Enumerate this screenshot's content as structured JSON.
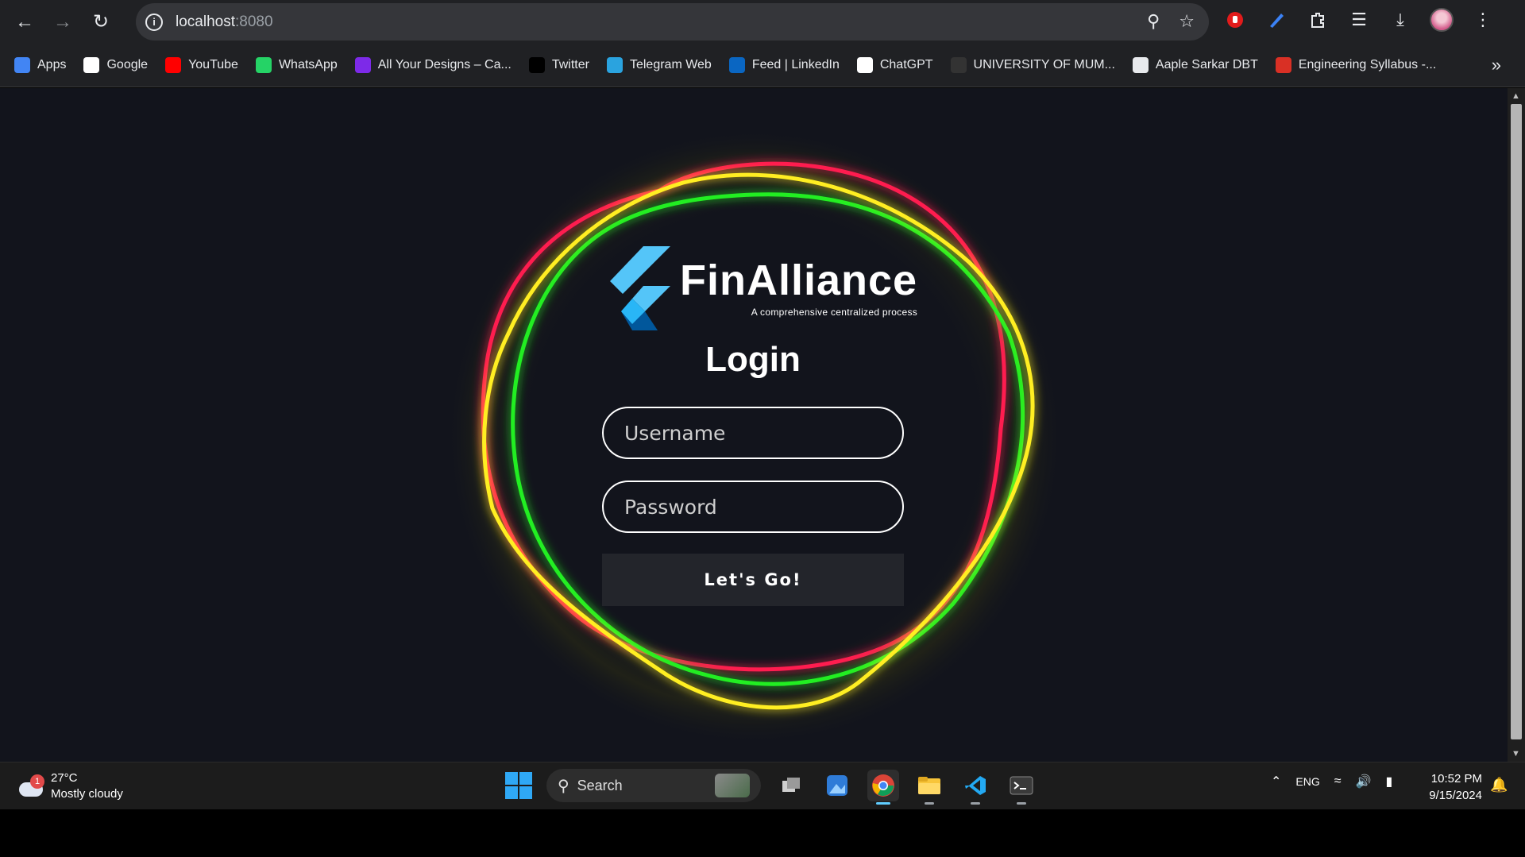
{
  "browser": {
    "url_host": "localhost",
    "url_port": ":8080"
  },
  "bookmarks": [
    {
      "label": "Apps",
      "icon": "apps-grid-icon",
      "color": "#4285f4"
    },
    {
      "label": "Google",
      "icon": "google-icon",
      "color": "#ffffff"
    },
    {
      "label": "YouTube",
      "icon": "youtube-icon",
      "color": "#ff0000"
    },
    {
      "label": "WhatsApp",
      "icon": "whatsapp-icon",
      "color": "#25d366"
    },
    {
      "label": "All Your Designs – Ca...",
      "icon": "canva-icon",
      "color": "#7d2ae8"
    },
    {
      "label": "Twitter",
      "icon": "x-icon",
      "color": "#000000"
    },
    {
      "label": "Telegram Web",
      "icon": "telegram-icon",
      "color": "#2aa3df"
    },
    {
      "label": "Feed | LinkedIn",
      "icon": "linkedin-icon",
      "color": "#0a66c2"
    },
    {
      "label": "ChatGPT",
      "icon": "chatgpt-icon",
      "color": "#ffffff"
    },
    {
      "label": "UNIVERSITY OF MUM...",
      "icon": "university-icon",
      "color": "#333333"
    },
    {
      "label": "Aaple Sarkar DBT",
      "icon": "document-icon",
      "color": "#e8eaed"
    },
    {
      "label": "Engineering Syllabus -...",
      "icon": "syllabus-icon",
      "color": "#d93025"
    }
  ],
  "app": {
    "brand": "FinAlliance",
    "tagline": "A comprehensive centralized process",
    "title": "Login",
    "username_placeholder": "Username",
    "password_placeholder": "Password",
    "submit_label": "Let's Go!",
    "ring_colors": [
      "#ff1f4f",
      "#22ee22",
      "#ffee22"
    ]
  },
  "taskbar": {
    "weather_temp": "27°C",
    "weather_desc": "Mostly cloudy",
    "weather_badge": "1",
    "search_label": "Search",
    "language": "ENG",
    "time": "10:52 PM",
    "date": "9/15/2024"
  }
}
